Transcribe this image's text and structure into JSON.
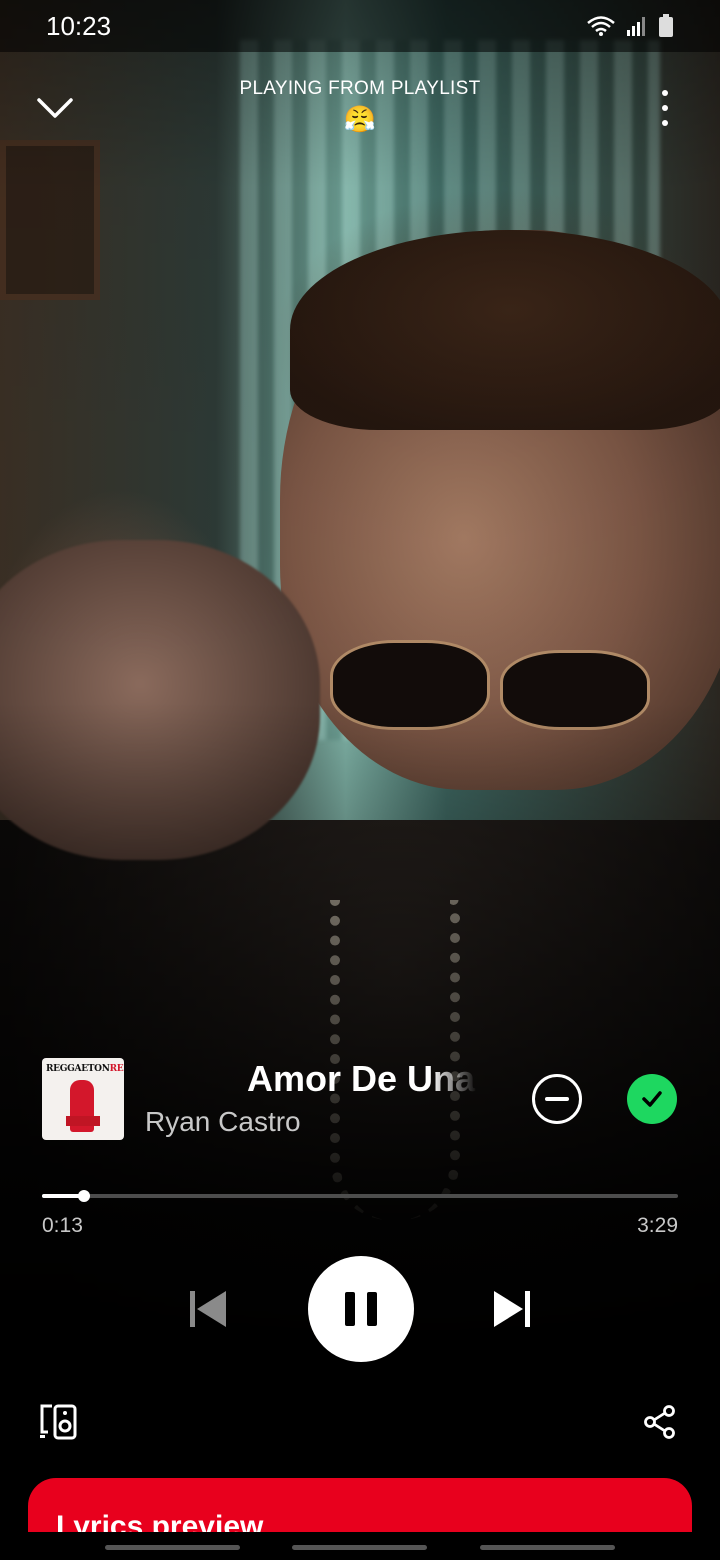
{
  "status_bar": {
    "time": "10:23"
  },
  "header": {
    "context_label": "PLAYING FROM PLAYLIST",
    "playlist_name": "😤"
  },
  "album_art": {
    "title_part1": "REGGAETON",
    "title_part2": "RED"
  },
  "track": {
    "title": "Amor De Una",
    "artist": "Ryan Castro",
    "liked": true
  },
  "playback": {
    "elapsed": "0:13",
    "duration": "3:29",
    "progress_fraction": 0.066,
    "state": "playing"
  },
  "lyrics": {
    "title": "Lyrics preview"
  },
  "colors": {
    "accent_green": "#1ed760",
    "lyrics_red": "#e8001d"
  },
  "icons": {
    "collapse": "chevron-down-icon",
    "more": "more-vertical-icon",
    "hide": "minus-circle-icon",
    "liked": "check-circle-icon",
    "prev": "skip-previous-icon",
    "pause": "pause-icon",
    "next": "skip-next-icon",
    "devices": "connect-devices-icon",
    "share": "share-icon"
  }
}
